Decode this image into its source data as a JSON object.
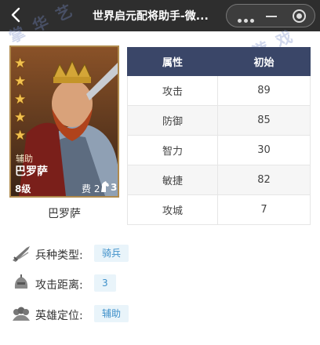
{
  "window": {
    "title": "世界启元配将助手-微..."
  },
  "hero": {
    "stars": 5,
    "role": "辅助",
    "name": "巴罗萨",
    "level": "8级",
    "cost_label": "费",
    "cost": "2",
    "cost_extra": "3",
    "label": "巴罗萨"
  },
  "stats": {
    "headers": [
      "属性",
      "初始"
    ],
    "rows": [
      {
        "name": "攻击",
        "value": "89"
      },
      {
        "name": "防御",
        "value": "85"
      },
      {
        "name": "智力",
        "value": "30"
      },
      {
        "name": "敏捷",
        "value": "82"
      },
      {
        "name": "攻城",
        "value": "7"
      }
    ]
  },
  "info": [
    {
      "label": "兵种类型:",
      "value": "骑兵",
      "icon": "sword-icon"
    },
    {
      "label": "攻击距离:",
      "value": "3",
      "icon": "helmet-icon"
    },
    {
      "label": "英雄定位:",
      "value": "辅助",
      "icon": "troops-icon"
    }
  ],
  "colors": {
    "header_bg": "#3a4668",
    "tag_bg": "#e9f4fa",
    "tag_text": "#3d8fc9",
    "star": "#f2c14e",
    "topbar": "#2e2e2e"
  }
}
